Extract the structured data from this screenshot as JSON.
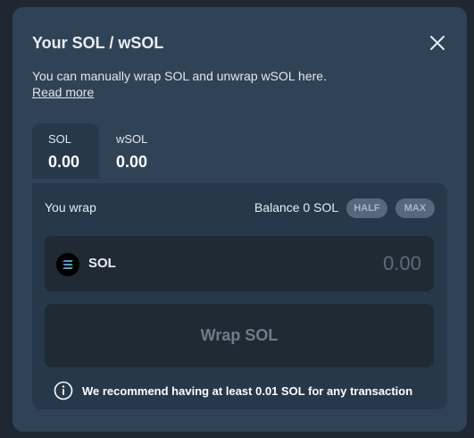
{
  "modal": {
    "title": "Your SOL / wSOL",
    "description": "You can manually wrap SOL and unwrap wSOL here.",
    "read_more": "Read more",
    "close_icon": "close-icon"
  },
  "tabs": [
    {
      "label": "SOL",
      "value": "0.00",
      "active": true
    },
    {
      "label": "wSOL",
      "value": "0.00",
      "active": false
    }
  ],
  "panel": {
    "you_wrap": "You wrap",
    "balance": "Balance 0 SOL",
    "half": "HALF",
    "max": "MAX",
    "token": "SOL",
    "token_icon": "solana-logo-icon",
    "amount_placeholder": "0.00",
    "button": "Wrap SOL",
    "info_icon": "info-icon",
    "info": "We recommend having at least 0.01 SOL for any transaction"
  }
}
